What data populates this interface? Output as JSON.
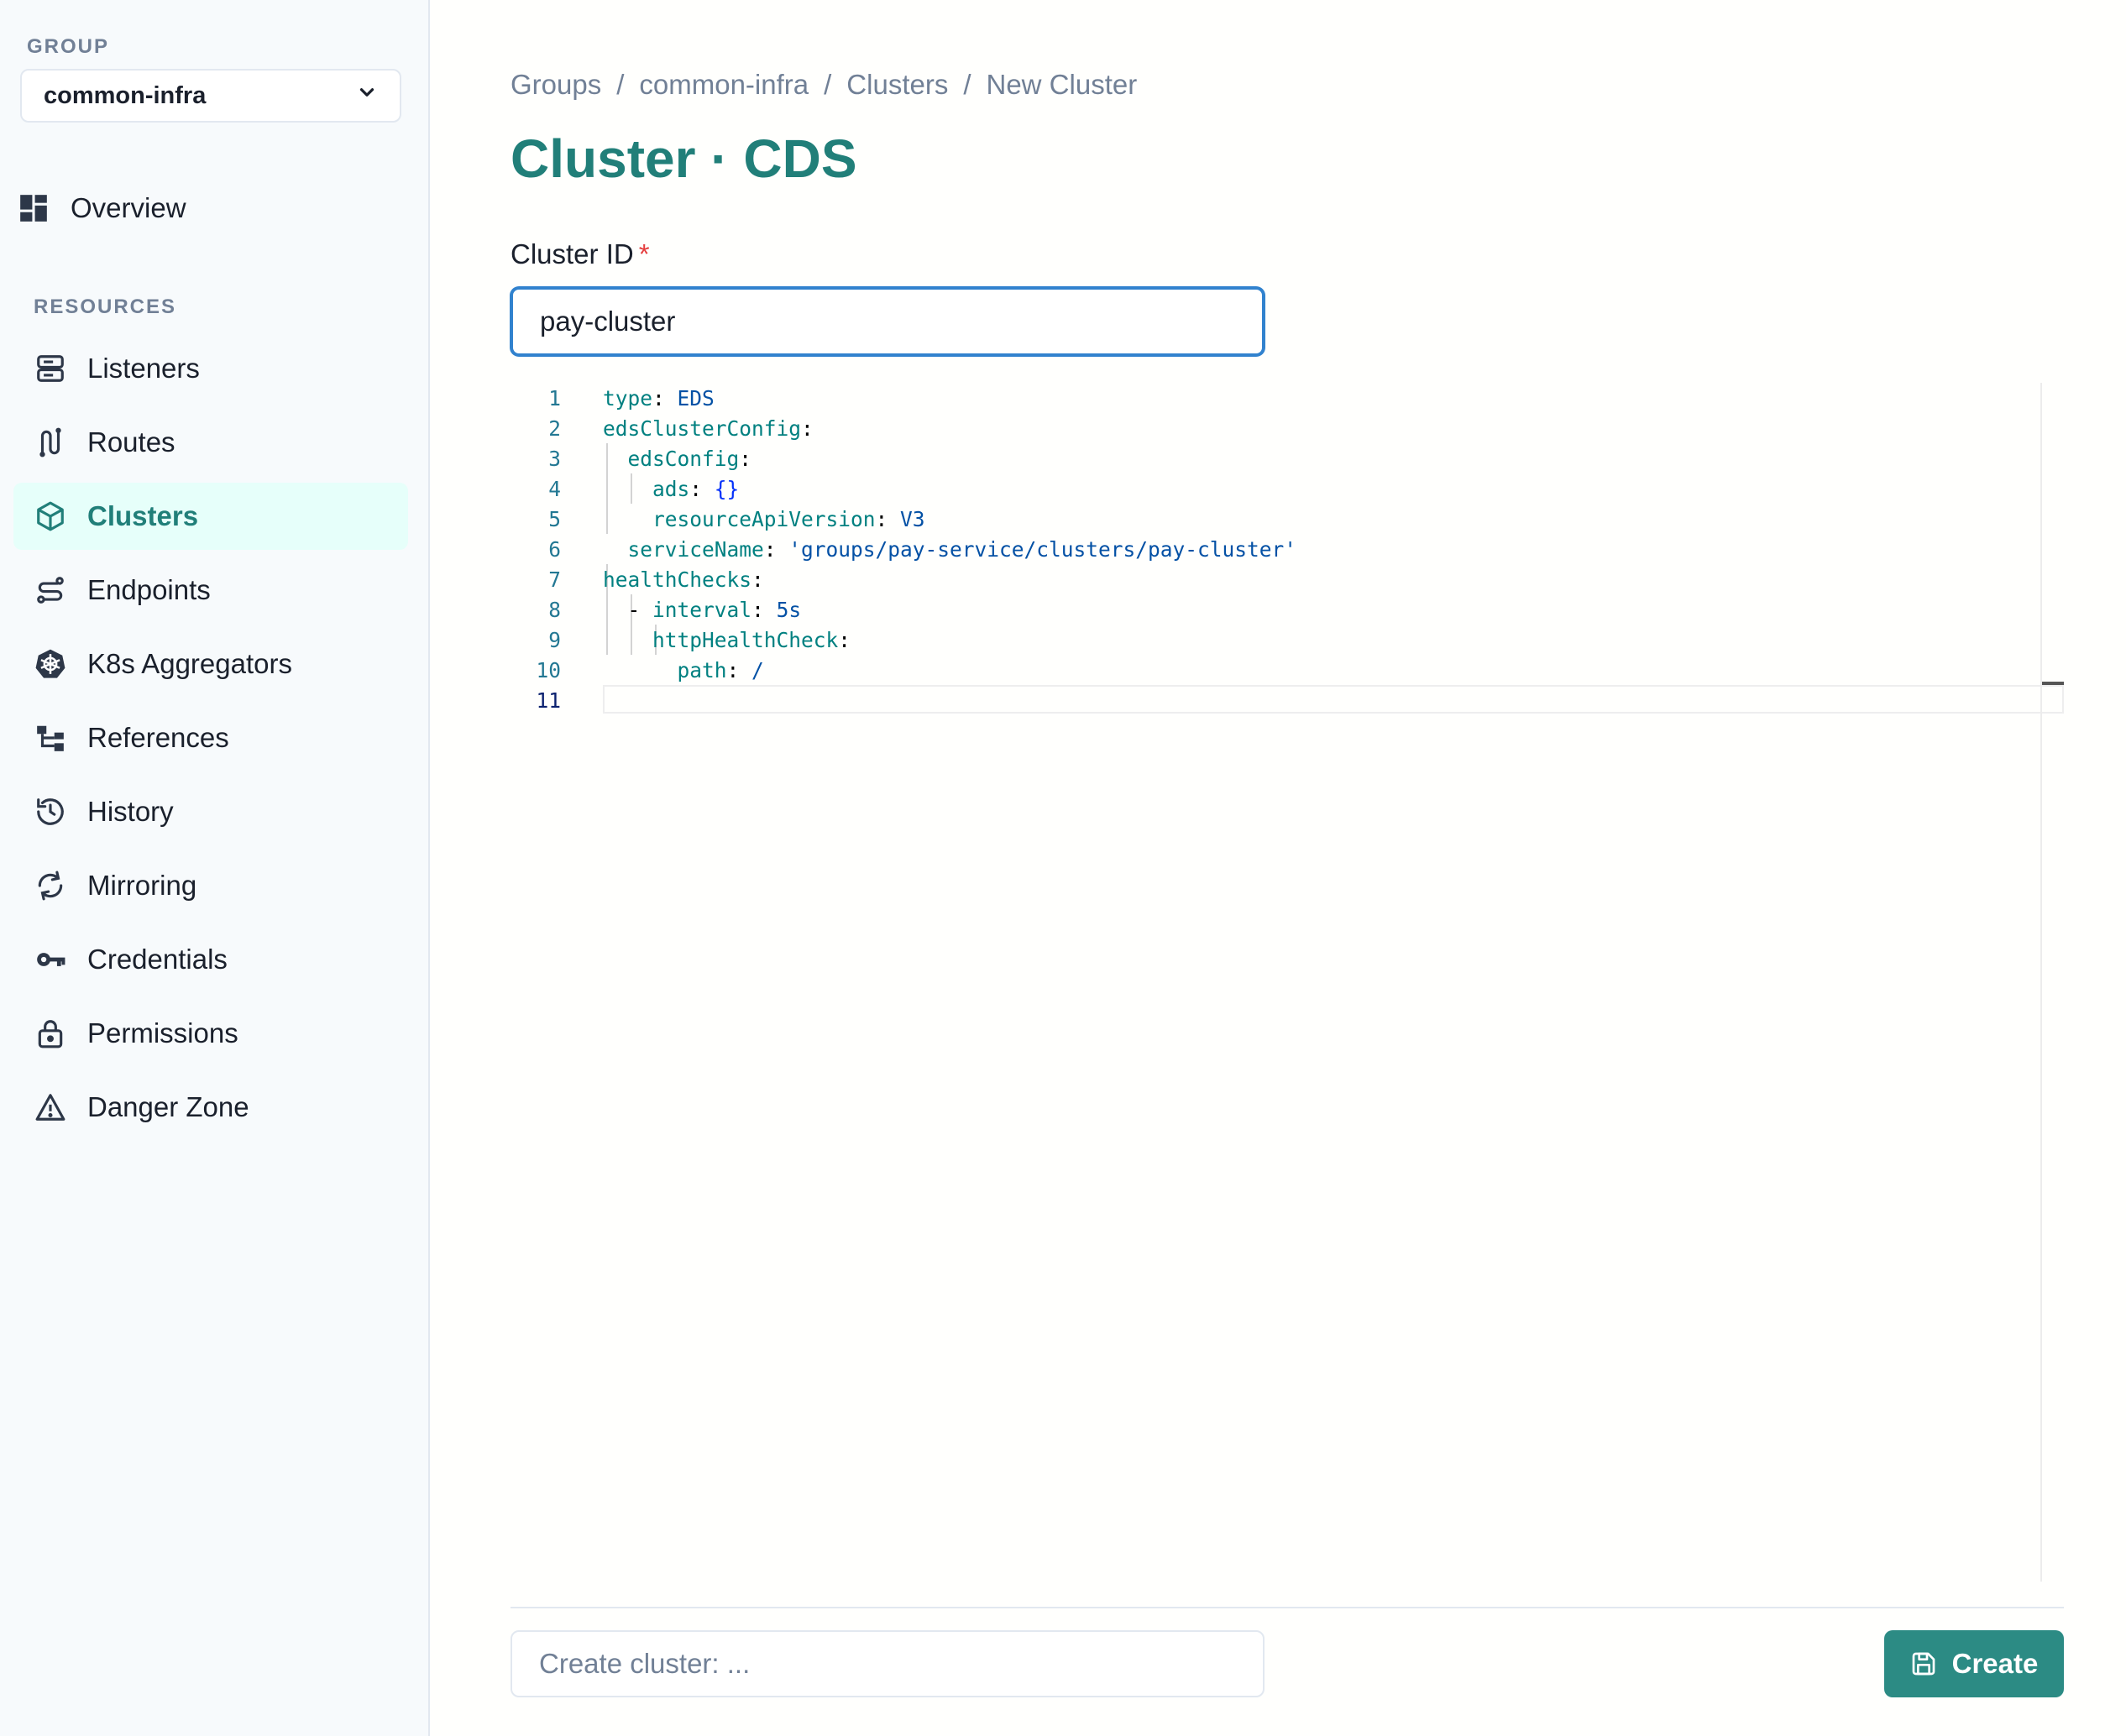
{
  "sidebar": {
    "group_label": "GROUP",
    "group_value": "common-infra",
    "overview_label": "Overview",
    "resources_label": "RESOURCES",
    "items": [
      {
        "label": "Listeners",
        "icon": "server-icon"
      },
      {
        "label": "Routes",
        "icon": "route-icon"
      },
      {
        "label": "Clusters",
        "icon": "cube-icon",
        "active": true
      },
      {
        "label": "Endpoints",
        "icon": "endpoint-path-icon"
      },
      {
        "label": "K8s Aggregators",
        "icon": "kubernetes-icon"
      },
      {
        "label": "References",
        "icon": "hierarchy-icon"
      },
      {
        "label": "History",
        "icon": "history-icon"
      },
      {
        "label": "Mirroring",
        "icon": "sync-icon"
      },
      {
        "label": "Credentials",
        "icon": "key-icon"
      },
      {
        "label": "Permissions",
        "icon": "lock-icon"
      },
      {
        "label": "Danger Zone",
        "icon": "warning-icon"
      }
    ]
  },
  "breadcrumb": [
    "Groups",
    "common-infra",
    "Clusters",
    "New Cluster"
  ],
  "breadcrumb_sep": "/",
  "page_title": "Cluster · CDS",
  "form": {
    "cluster_id_label": "Cluster ID",
    "required_mark": "*",
    "cluster_id_value": "pay-cluster"
  },
  "editor": {
    "line_numbers": [
      "1",
      "2",
      "3",
      "4",
      "5",
      "6",
      "7",
      "8",
      "9",
      "10",
      "11"
    ],
    "lines": [
      {
        "key": "type",
        "value": "EDS"
      },
      {
        "key": "edsClusterConfig",
        "value": ""
      },
      {
        "key": "edsConfig",
        "value": ""
      },
      {
        "key": "ads",
        "value": "{}"
      },
      {
        "key": "resourceApiVersion",
        "value": "V3"
      },
      {
        "key": "serviceName",
        "value": "'groups/pay-service/clusters/pay-cluster'"
      },
      {
        "key": "healthChecks",
        "value": ""
      },
      {
        "dash": "-",
        "key": "interval",
        "value": "5s"
      },
      {
        "key": "httpHealthCheck",
        "value": ""
      },
      {
        "key": "path",
        "value": "/"
      }
    ]
  },
  "footer": {
    "commit_placeholder": "Create cluster: ...",
    "create_label": "Create"
  },
  "colors": {
    "accent": "#217f79",
    "button": "#2c8b84",
    "active_bg": "#e6fffa",
    "focus_border": "#3182ce"
  }
}
